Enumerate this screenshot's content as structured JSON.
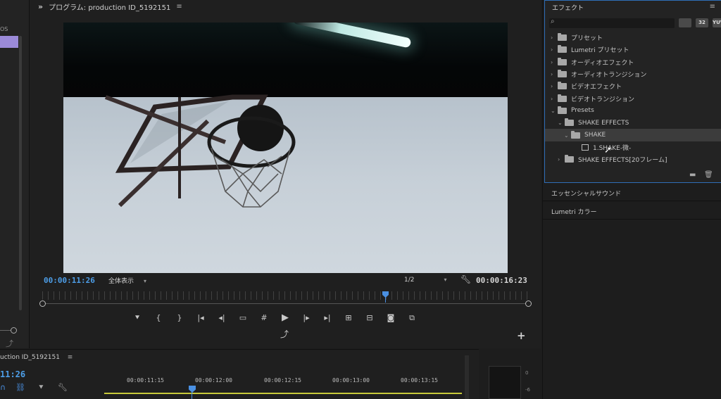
{
  "project": {
    "label": "OS"
  },
  "program_monitor": {
    "title": "プログラム: production ID_5192151",
    "timecode_current": "00:00:11:26",
    "timecode_duration": "00:00:16:23",
    "zoom_level": "全体表示",
    "resolution": "1/2"
  },
  "effects": {
    "title": "エフェクト",
    "search_placeholder": "",
    "toolbar_icons": [
      "accelerated-effects-icon",
      "32bit-color-icon",
      "yuv-effects-icon"
    ],
    "toolbar_labels": [
      "",
      "32",
      "YUV"
    ],
    "tree": [
      {
        "label": "プリセット",
        "arrow": "›",
        "icon": "folder"
      },
      {
        "label": "Lumetri プリセット",
        "arrow": "›",
        "icon": "folder"
      },
      {
        "label": "オーディオエフェクト",
        "arrow": "›",
        "icon": "folder"
      },
      {
        "label": "オーディオトランジション",
        "arrow": "›",
        "icon": "folder"
      },
      {
        "label": "ビデオエフェクト",
        "arrow": "›",
        "icon": "folder"
      },
      {
        "label": "ビデオトランジション",
        "arrow": "›",
        "icon": "folder"
      },
      {
        "label": "Presets",
        "arrow": "⌄",
        "icon": "folder"
      },
      {
        "label": "SHAKE EFFECTS",
        "arrow": "⌄",
        "icon": "folder"
      },
      {
        "label": "SHAKE",
        "arrow": "⌄",
        "icon": "folder",
        "selected": true
      },
      {
        "label": "1.SHAKE-微-",
        "arrow": "",
        "icon": "preset"
      },
      {
        "label": "SHAKE EFFECTS[20フレーム]",
        "arrow": "›",
        "icon": "folder"
      }
    ]
  },
  "panels": {
    "essential_sound": "エッセンシャルサウンド",
    "lumetri_color": "Lumetri カラー"
  },
  "timeline": {
    "sequence_name": "uction ID_5192151",
    "timecode": "11:26",
    "ruler_ticks": [
      "00:00:11:15",
      "00:00:12:00",
      "00:00:12:15",
      "00:00:13:00",
      "00:00:13:15"
    ]
  },
  "audio_meter": {
    "levels": [
      "0",
      "-6"
    ]
  }
}
